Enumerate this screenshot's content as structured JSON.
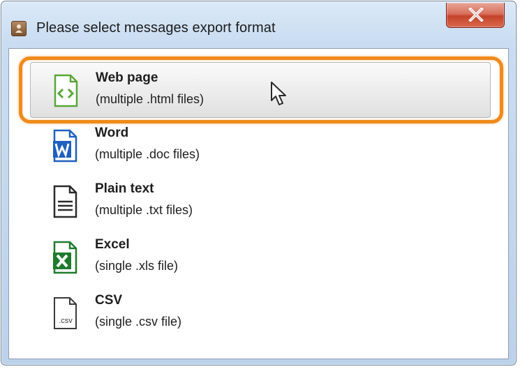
{
  "window": {
    "title": "Please select messages export format",
    "app_icon": "app-icon",
    "close_icon": "close-icon"
  },
  "options": [
    {
      "name": "Web page",
      "description": "(multiple .html files)",
      "icon": "web-page-icon",
      "selected": true
    },
    {
      "name": "Word",
      "description": "(multiple .doc files)",
      "icon": "word-icon",
      "selected": false
    },
    {
      "name": "Plain text",
      "description": "(multiple .txt files)",
      "icon": "plain-text-icon",
      "selected": false
    },
    {
      "name": "Excel",
      "description": "(single .xls file)",
      "icon": "excel-icon",
      "selected": false
    },
    {
      "name": "CSV",
      "description": "(single .csv file)",
      "icon": "csv-icon",
      "selected": false,
      "icon_label": ".csv"
    }
  ],
  "colors": {
    "highlight": "#f08a1c",
    "web_page_icon": "#5aa63a",
    "word_icon": "#1f5fbf",
    "excel_icon": "#1f7a2e",
    "close_button": "#c4432a"
  }
}
